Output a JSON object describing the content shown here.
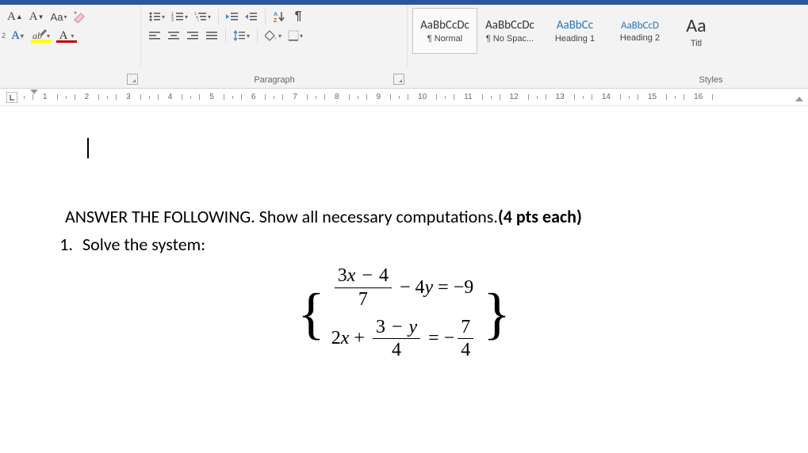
{
  "ribbon": {
    "font": {
      "grow": "A",
      "shrink": "A",
      "case": "Aa",
      "outlineA_left": "A",
      "highlightLabel": "ab",
      "outlineA_right": "A",
      "superscript2": "2"
    },
    "paragraph": {
      "label": "Paragraph",
      "sortLabel": "A↓Z",
      "pilcrow": "¶"
    },
    "styles": {
      "label": "Styles",
      "items": [
        {
          "preview": "AaBbCcDc",
          "name": "¶ Normal",
          "cls": ""
        },
        {
          "preview": "AaBbCcDc",
          "name": "¶ No Spac...",
          "cls": ""
        },
        {
          "preview": "AaBbCc",
          "name": "Heading 1",
          "cls": "blue"
        },
        {
          "preview": "AaBbCcD",
          "name": "Heading 2",
          "cls": "blue"
        },
        {
          "preview": "Aa",
          "name": "Titl",
          "cls": "title"
        }
      ]
    }
  },
  "ruler": {
    "marks": [
      1,
      2,
      3,
      4,
      5,
      6,
      7,
      8,
      9,
      10,
      11,
      12,
      13,
      14,
      15,
      16
    ]
  },
  "document": {
    "instruction_prefix": "ANSWER THE FOLLOWING. Show all necessary computations.",
    "instruction_bold": "(4 pts each)",
    "item1_num": "1.",
    "item1_text": "Solve the system:",
    "eq1": {
      "num": "3x − 4",
      "den": "7",
      "mid": "− 4y = −9"
    },
    "eq2": {
      "pre": "2x +",
      "num": "3 − y",
      "den": "4",
      "eq": "= −",
      "rnum": "7",
      "rden": "4"
    }
  }
}
